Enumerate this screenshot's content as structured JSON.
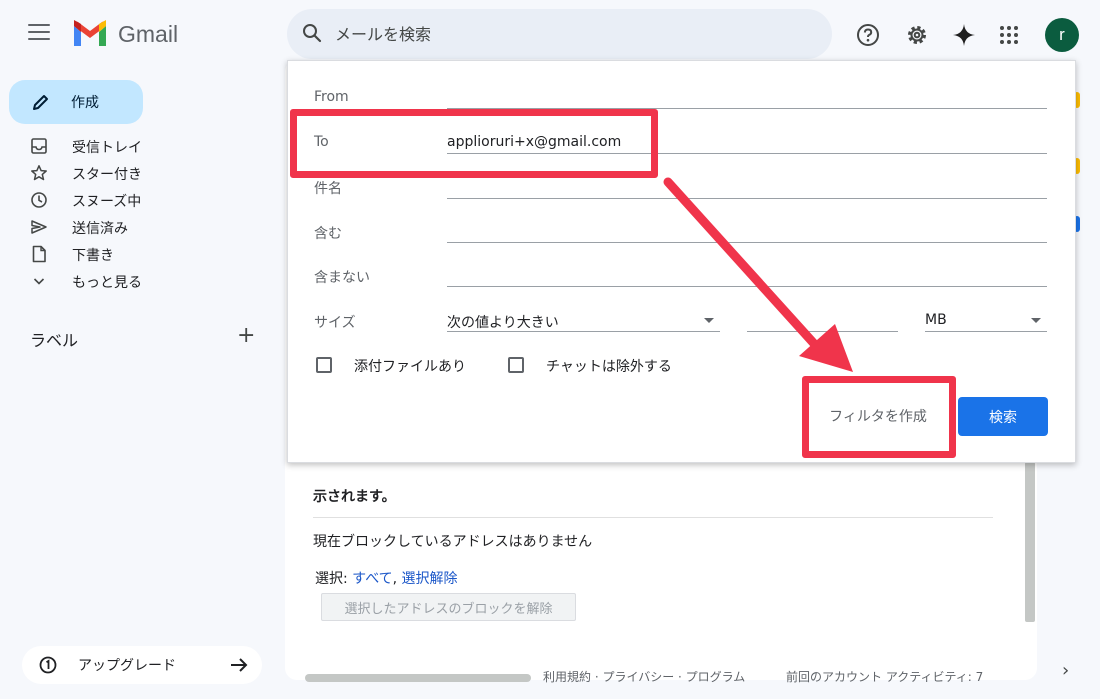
{
  "header": {
    "app_name": "Gmail",
    "search_placeholder": "メールを検索",
    "avatar_initial": "r"
  },
  "sidebar": {
    "compose_label": "作成",
    "items": [
      {
        "label": "受信トレイ",
        "icon": "inbox-icon"
      },
      {
        "label": "スター付き",
        "icon": "star-icon"
      },
      {
        "label": "スヌーズ中",
        "icon": "clock-icon"
      },
      {
        "label": "送信済み",
        "icon": "send-icon"
      },
      {
        "label": "下書き",
        "icon": "draft-icon"
      },
      {
        "label": "もっと見る",
        "icon": "chevron-down-icon"
      }
    ],
    "labels_title": "ラベル",
    "add_label_symbol": "+",
    "upgrade_label": "アップグレード"
  },
  "search_options": {
    "from_label": "From",
    "from_value": "",
    "to_label": "To",
    "to_value": "applioruri+x@gmail.com",
    "subject_label": "件名",
    "subject_value": "",
    "has_words_label": "含む",
    "has_words_value": "",
    "doesnt_have_label": "含まない",
    "doesnt_have_value": "",
    "size_label": "サイズ",
    "size_operator": "次の値より大きい",
    "size_value": "",
    "size_unit": "MB",
    "has_attachment_label": "添付ファイルあり",
    "has_attachment_checked": false,
    "exclude_chats_label": "チャットは除外する",
    "exclude_chats_checked": false,
    "create_filter_label": "フィルタを作成",
    "search_button_label": "検索"
  },
  "content": {
    "partial_text": "示されます。",
    "no_blocked_text": "現在ブロックしているアドレスはありません",
    "select_prefix": "選択: ",
    "select_all": "すべて",
    "select_separator": ", ",
    "select_none": "選択解除",
    "unblock_button": "選択したアドレスのブロックを解除",
    "footer_links": "利用規約 · プライバシー · プログラム",
    "footer_activity": "前回のアカウント アクティビティ: 7"
  },
  "colors": {
    "annotation_red": "#f0344b",
    "primary_blue": "#1a73e8",
    "compose_bg": "#c2e7ff"
  }
}
